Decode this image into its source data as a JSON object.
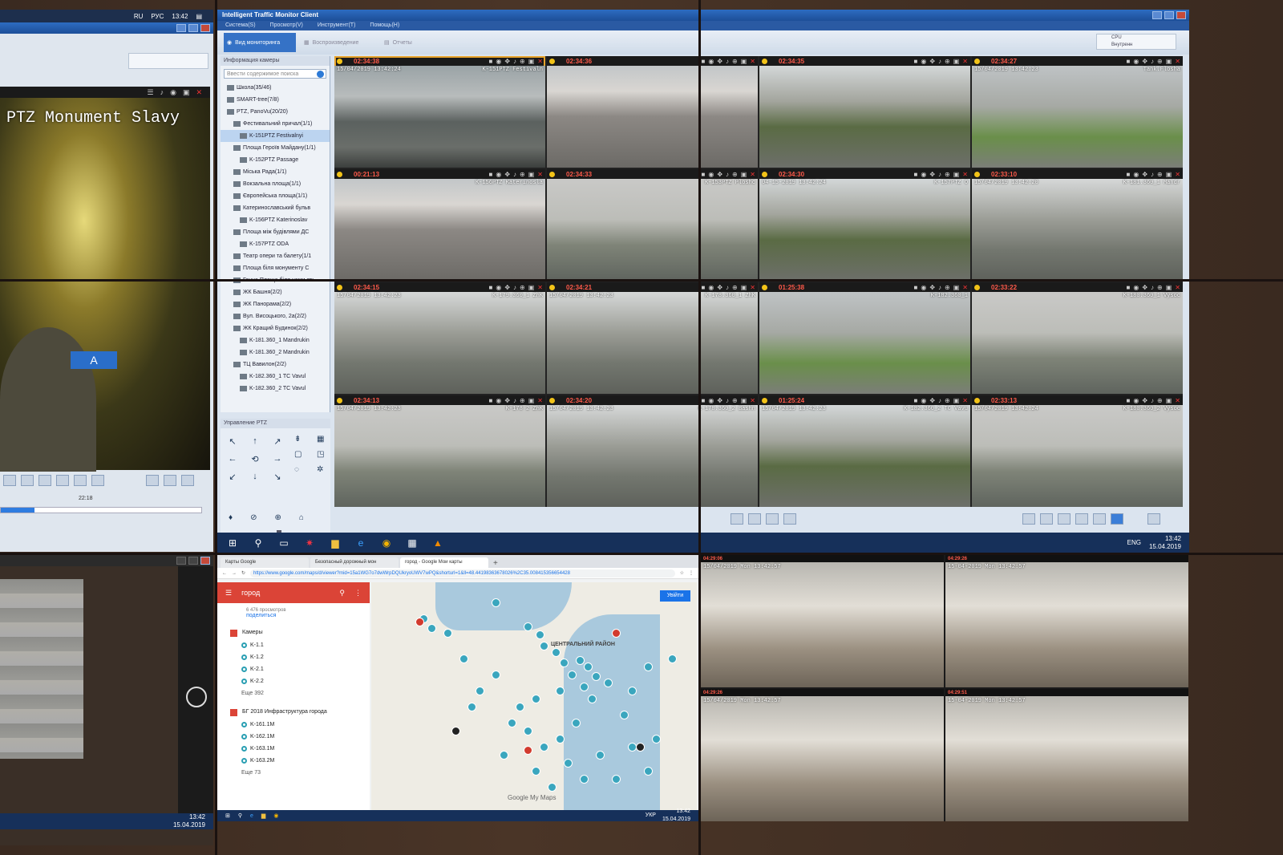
{
  "left_top": {
    "tray_lang": "RU",
    "tray_kb": "РУС",
    "tray_time": "13:42",
    "overlay_title": "PTZ Monument Slavy",
    "timeline_label": "22:18"
  },
  "main_client": {
    "title": "Intelligent Traffic Monitor Client",
    "menu": [
      "Система(S)",
      "Просмотр(V)",
      "Инструмент(T)",
      "Помощь(H)"
    ],
    "toolbar_tabs": [
      "Вид мониторинга",
      "Воспроизведение",
      "Отчеты"
    ],
    "cpu_label": "CPU",
    "cpu_sub": "Внутренн",
    "tree_header": "Информация камеры",
    "search_placeholder": "Ввести содержимое поиска",
    "tree_items": [
      {
        "label": "Школа(35/46)",
        "indent": 1,
        "sel": false
      },
      {
        "label": "SMART-tree(7/8)",
        "indent": 1,
        "sel": false
      },
      {
        "label": "PTZ, PanoVu(20/20)",
        "indent": 1,
        "sel": false
      },
      {
        "label": "Фестивальний причал(1/1)",
        "indent": 2,
        "sel": false
      },
      {
        "label": "K-151PTZ Festivalnyi",
        "indent": 3,
        "sel": true
      },
      {
        "label": "Площа Героїв Майдану(1/1)",
        "indent": 2,
        "sel": false
      },
      {
        "label": "K-152PTZ Passage",
        "indent": 3,
        "sel": false
      },
      {
        "label": "Міська Рада(1/1)",
        "indent": 2,
        "sel": false
      },
      {
        "label": "Вокзальна площа(1/1)",
        "indent": 2,
        "sel": false
      },
      {
        "label": "Європейська площа(1/1)",
        "indent": 2,
        "sel": false
      },
      {
        "label": "Катеринославський бульв",
        "indent": 2,
        "sel": false
      },
      {
        "label": "K-156PTZ Katerinoslav",
        "indent": 3,
        "sel": false
      },
      {
        "label": "Площа між будівлями ДС",
        "indent": 2,
        "sel": false
      },
      {
        "label": "K-157PTZ ODA",
        "indent": 3,
        "sel": false
      },
      {
        "label": "Театр опери та балету(1/1",
        "indent": 2,
        "sel": false
      },
      {
        "label": "Площа біля монументу С",
        "indent": 2,
        "sel": false
      },
      {
        "label": "Ганна Площа біля нами ять",
        "indent": 2,
        "sel": false
      },
      {
        "label": "ЖК Башня(2/2)",
        "indent": 2,
        "sel": false
      },
      {
        "label": "ЖК Панорама(2/2)",
        "indent": 2,
        "sel": false
      },
      {
        "label": "Вул. Висоцького, 2а(2/2)",
        "indent": 2,
        "sel": false
      },
      {
        "label": "ЖК Кращий Будинок(2/2)",
        "indent": 2,
        "sel": false
      },
      {
        "label": "K-181.360_1 Mandrukin",
        "indent": 3,
        "sel": false
      },
      {
        "label": "K-181.360_2 Mandrukin",
        "indent": 3,
        "sel": false
      },
      {
        "label": "ТЦ Вавилон(2/2)",
        "indent": 2,
        "sel": false
      },
      {
        "label": "K-182.360_1 TC Vavul",
        "indent": 3,
        "sel": false
      },
      {
        "label": "K-182.360_2 TC Vavul",
        "indent": 3,
        "sel": false
      }
    ],
    "ptz_header": "Управление PTZ",
    "ptz_arrows": [
      "↖",
      "↑",
      "↗",
      "←",
      "⟲",
      "→",
      "↙",
      "↓",
      "↘"
    ],
    "cameras": [
      {
        "time": "02:34:38",
        "osd_l": "15/04/2019 13:42:24",
        "osd_r": "K-151PTZ Festivaln",
        "scene": "s1",
        "sel": true
      },
      {
        "time": "02:34:36",
        "osd_l": "",
        "osd_r": "",
        "scene": "s2",
        "sel": false
      },
      {
        "time": "02:34:35",
        "osd_l": "",
        "osd_r": "",
        "scene": "s3",
        "sel": false
      },
      {
        "time": "02:34:27",
        "osd_l": "15/04/2019 13:42:23",
        "osd_r": "Tank.Flosha",
        "scene": "s4",
        "sel": false
      },
      {
        "time": "00:21:13",
        "osd_l": "",
        "osd_r": "K-156PTZ Katerinosla",
        "scene": "s2",
        "sel": false
      },
      {
        "time": "02:34:33",
        "osd_l": "",
        "osd_r": "K-153PTZ Ploshc",
        "scene": "s5",
        "sel": false
      },
      {
        "time": "02:34:30",
        "osd_l": "04-15-2019 13:42:24",
        "osd_r": "K-157PTZ O",
        "scene": "s3",
        "sel": false
      },
      {
        "time": "02:33:10",
        "osd_l": "15/04/2019 13:42:20",
        "osd_r": "K-181.360_1 Mandr",
        "scene": "s6",
        "sel": false
      },
      {
        "time": "02:34:15",
        "osd_l": "15/04/2019 13:42:23",
        "osd_r": "K-179.360_1 ZhK",
        "scene": "s6",
        "sel": false
      },
      {
        "time": "02:34:21",
        "osd_l": "15/04/2019 13:42:23",
        "osd_r": "K-178.360_1 ZhK",
        "scene": "s6",
        "sel": false
      },
      {
        "time": "01:25:38",
        "osd_l": "",
        "osd_r": "K-182.360_1",
        "scene": "s4",
        "sel": false
      },
      {
        "time": "02:33:22",
        "osd_l": "",
        "osd_r": "K-180.360_1 Vysoc",
        "scene": "s5",
        "sel": false
      },
      {
        "time": "02:34:13",
        "osd_l": "15/04/2019 13:42:23",
        "osd_r": "K-178 2 ZhK",
        "scene": "s5",
        "sel": false
      },
      {
        "time": "02:34:20",
        "osd_l": "15/04/2019 13:42:23",
        "osd_r": "K-178.360_2 Bashn",
        "scene": "s6",
        "sel": false
      },
      {
        "time": "01:25:24",
        "osd_l": "15/04/2019 13:42:23",
        "osd_r": "K-182.360_2 TC Vavu",
        "scene": "s3",
        "sel": false
      },
      {
        "time": "02:33:13",
        "osd_l": "15/04/2019 13:42:24",
        "osd_r": "K-180.360_2 Vysoc",
        "scene": "s5",
        "sel": false
      }
    ]
  },
  "taskbar_mid": {
    "lang": "ENG",
    "time": "13:42",
    "date": "15.04.2019"
  },
  "browser": {
    "tabs": [
      "Карты Google",
      "Безопасный дорожный мон",
      "город - Google Мои карты"
    ],
    "url": "https://www.google.com/maps/d/viewer?mid=15a1WG7o7dwWrpDQUkryoUWV7wPQ&shorturl=1&ll=48.44198363678026%2C35.008415356654428",
    "map_title": "город",
    "views": "6 476 просмотров",
    "share": "поделиться",
    "layer1": "Камеры",
    "layer1_items": [
      "K-1.1",
      "K-1.2",
      "K-2.1",
      "K-2.2"
    ],
    "layer1_more": "Еще 392",
    "layer2": "БГ 2018 Инфраструктура города",
    "layer2_items": [
      "K-161.1M",
      "K-162.1M",
      "K-163.1M",
      "K-163.2M"
    ],
    "layer2_more": "Еще 73",
    "open_btn": "Увійти",
    "map_brand": "Google My Maps",
    "map_label": "ЦЕНТРАЛЬНИЙ РАЙОН",
    "lang": "УКР",
    "time": "13:42",
    "date": "15.04.2019"
  },
  "indoor": [
    {
      "time": "04:29:06",
      "osd": "15/04/2019 Mon 13:42:57"
    },
    {
      "time": "04:29:26",
      "osd": "15-04-2019 Mon 13:42:57"
    },
    {
      "time": "04:29:26",
      "osd": "15/04/2019 Mon 13:42:57"
    },
    {
      "time": "04:29:51",
      "osd": "15-04-2019 Mon 13:42:57"
    }
  ],
  "left_bottom": {
    "time": "13:42",
    "date": "15.04.2019"
  }
}
